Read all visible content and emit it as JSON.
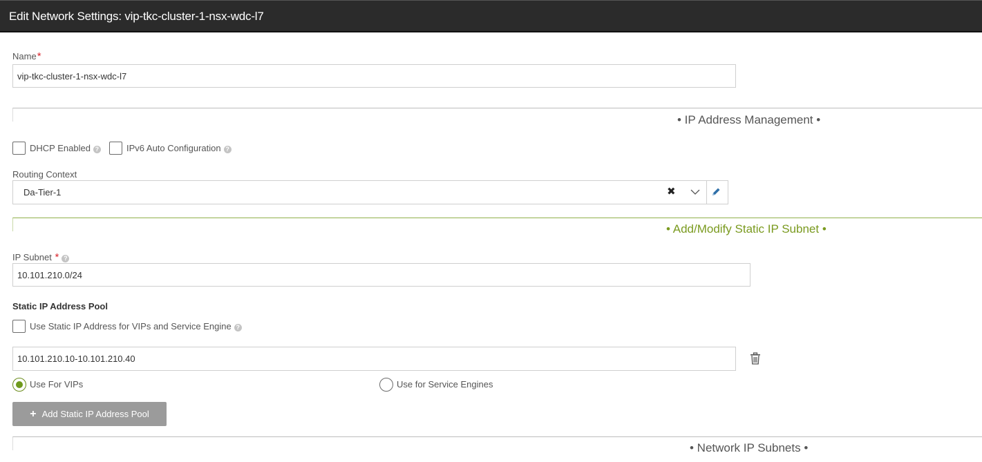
{
  "window": {
    "title": "Edit Network Settings: vip-tkc-cluster-1-nsx-wdc-l7"
  },
  "name_field": {
    "label": "Name",
    "required_mark": "*",
    "value": "vip-tkc-cluster-1-nsx-wdc-l7"
  },
  "ip_management": {
    "section_title": "• IP Address Management •",
    "dhcp_label": "DHCP Enabled",
    "dhcp_checked": false,
    "ipv6_label": "IPv6 Auto Configuration",
    "ipv6_checked": false,
    "routing_context": {
      "label": "Routing Context",
      "value": "Da-Tier-1",
      "clear_glyph": "✖"
    }
  },
  "static_subnet": {
    "section_title": "• Add/Modify Static IP Subnet •",
    "ip_subnet_label": "IP Subnet",
    "required_mark": "*",
    "ip_subnet_value": "10.101.210.0/24",
    "pool_heading": "Static IP Address Pool",
    "use_static_label": "Use Static IP Address for VIPs and Service Engine",
    "use_static_checked": false,
    "pool_range_value": "10.101.210.10-10.101.210.40",
    "use_for_vips_label": "Use For VIPs",
    "use_for_vips_selected": true,
    "use_for_se_label": "Use for Service Engines",
    "use_for_se_selected": false,
    "add_pool_button": "Add Static IP Address Pool",
    "add_pool_plus": "+"
  },
  "network_subnets": {
    "section_title": "• Network IP Subnets •"
  },
  "colors": {
    "titlebar_bg": "#2b2b2b",
    "accent_green": "#7a9a1f",
    "required_red": "#d9272e",
    "button_gray": "#9b9b9b"
  },
  "icons": {
    "help": "question-circle-icon",
    "clear": "close-icon",
    "dropdown": "chevron-down-icon",
    "edit": "pencil-icon",
    "delete": "trash-icon",
    "add": "plus-icon"
  }
}
